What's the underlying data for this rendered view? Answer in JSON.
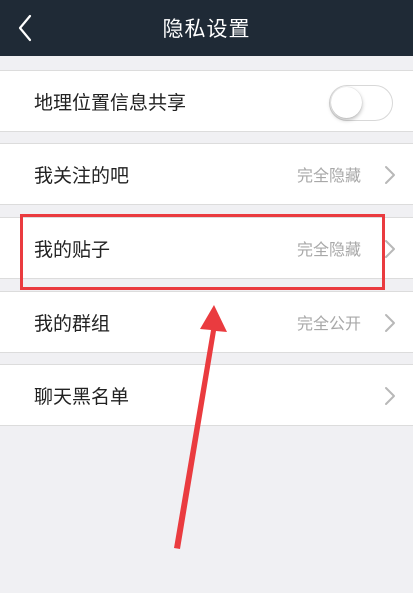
{
  "header": {
    "title": "隐私设置"
  },
  "rows": [
    {
      "label": "地理位置信息共享",
      "control": "toggle",
      "enabled": false
    },
    {
      "label": "我关注的吧",
      "value": "完全隐藏"
    },
    {
      "label": "我的贴子",
      "value": "完全隐藏"
    },
    {
      "label": "我的群组",
      "value": "完全公开"
    },
    {
      "label": "聊天黑名单"
    }
  ],
  "colors": {
    "navbar": "#1f2a36",
    "background": "#f0f0f3",
    "annotation": "#ea3b3f"
  }
}
